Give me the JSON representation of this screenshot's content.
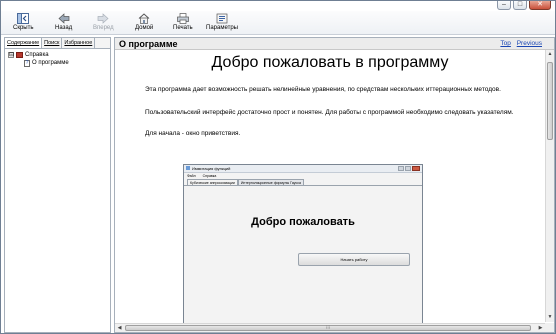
{
  "window": {
    "controls": {
      "minimize": "–",
      "maximize": "□",
      "close": "✕"
    }
  },
  "toolbar": {
    "buttons": [
      {
        "label": "Скрыть",
        "icon": "hide-pane-icon",
        "enabled": true
      },
      {
        "label": "Назад",
        "icon": "back-arrow-icon",
        "enabled": true
      },
      {
        "label": "Вперед",
        "icon": "forward-arrow-icon",
        "enabled": false
      },
      {
        "label": "Домой",
        "icon": "home-icon",
        "enabled": true
      },
      {
        "label": "Печать",
        "icon": "print-icon",
        "enabled": true
      },
      {
        "label": "Параметры",
        "icon": "options-icon",
        "enabled": true
      }
    ]
  },
  "sidebar": {
    "tabs": [
      "Содержание",
      "Поиск",
      "Избранное"
    ],
    "active_tab": "Содержание",
    "tree": [
      {
        "label": "Справка",
        "expander": "⊟",
        "icon": "book-icon"
      },
      {
        "label": "О программе",
        "icon": "doc-icon",
        "doc_glyph": "?"
      }
    ]
  },
  "topic": {
    "title": "О программе",
    "links": [
      "Top",
      "Previous"
    ],
    "heading": "Добро пожаловать в программу",
    "paragraph1": "Эта программа дает возможность решать нелинейные уравнения, по средствам нескольких иттерационных методов.",
    "paragraph2": "Пользовательский интерфейс достаточно прост и понятен. Для работы с программой необходимо следовать указателям.",
    "paragraph3": "Для начала - окно приветствия."
  },
  "embedded_screenshot": {
    "title": "Иммитация функций",
    "menu": [
      "Файл",
      "Справка"
    ],
    "tabs": [
      "Кубические аппроксимации",
      "Интерполяционные формулы Гаусса"
    ],
    "heading": "Добро пожаловать",
    "button": "Начать работу"
  },
  "scroll": {
    "grip": "⁝⁝⁝"
  },
  "colors": {
    "link": "#1a46b3",
    "close_button": "#c9503a",
    "book": "#b5372c"
  }
}
